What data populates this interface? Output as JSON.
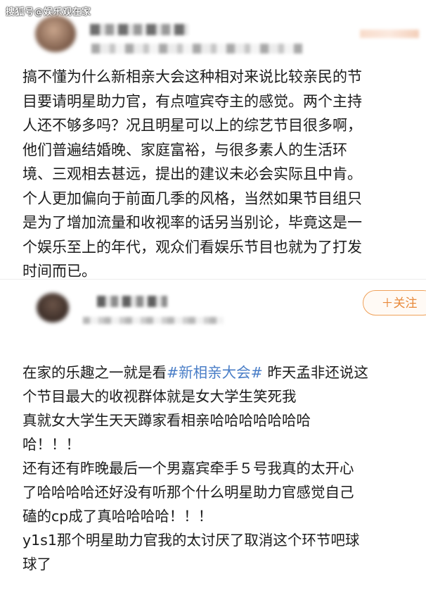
{
  "watermark": "搜狐号@娱乐观在家",
  "post1": {
    "body": "搞不懂为什么新相亲大会这种相对来说比较亲民的节\n目要请明星助力官，有点喧宾夺主的感觉。两个主持\n人还不够多吗？况且明星可以上的综艺节目很多啊，\n他们普遍结婚晚、家庭富裕，与很多素人的生活环\n境、三观相去甚远，提出的建议未必会实际且中肯。\n个人更加偏向于前面几季的风格，当然如果节目组只\n是为了增加流量和收视率的话另当别论，毕竟这是一\n个娱乐至上的年代，观众们看娱乐节目也就为了打发\n时间而已。"
  },
  "post2": {
    "follow_label": "＋关注",
    "line1_prefix": "在家的乐趣之一就是看",
    "line1_hashtag": "#新相亲大会#",
    "line1_suffix": " 昨天孟非还说这",
    "rest": "个节目最大的收视群体就是女大学生笑死我\n真就女大学生天天蹲家看相亲哈哈哈哈哈哈哈\n哈！！！\n还有还有昨晚最后一个男嘉宾牵手５号我真的太开心\n了哈哈哈哈还好没有听那个什么明星助力官感觉自己\n磕的cp成了真哈哈哈哈！！！\ny1s1那个明星助力官我的太讨厌了取消这个环节吧球\n球了"
  }
}
